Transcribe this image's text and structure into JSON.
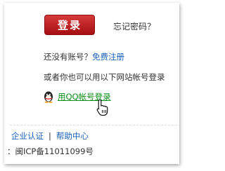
{
  "login": {
    "button_label": "登录",
    "forgot_password": "忘记密码？"
  },
  "register": {
    "prompt": "还没有账号？",
    "link": "免费注册"
  },
  "alt_login": {
    "text": "或者你也可以用以下网站帐号登录",
    "qq_link": "用QQ帐号登录"
  },
  "footer": {
    "links": [
      "企业认证",
      "帮助中心"
    ],
    "separator": "|",
    "icp": "：闽ICP备11011099号"
  },
  "icons": {
    "qq": "qq-penguin-icon",
    "cursor": "hand-pointer-icon"
  },
  "colors": {
    "accent_red": "#b81c1f",
    "link_blue": "#1a61b7",
    "qq_link_green": "#0a8c18"
  }
}
